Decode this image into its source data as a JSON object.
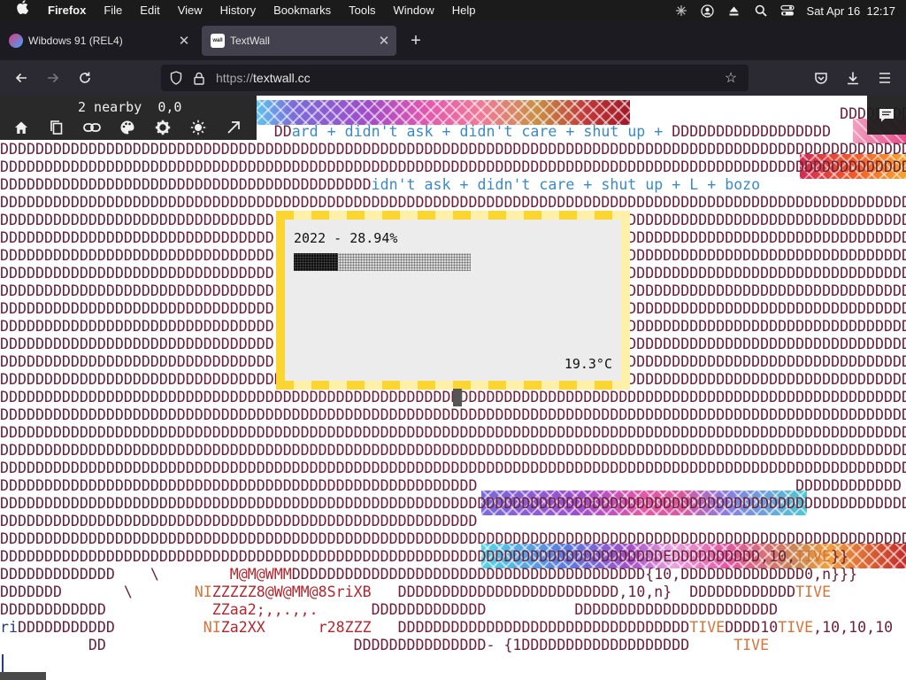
{
  "menubar": {
    "app_name": "Firefox",
    "menus": [
      "File",
      "Edit",
      "View",
      "History",
      "Bookmarks",
      "Tools",
      "Window",
      "Help"
    ],
    "clock": "Sat Apr 16  12:17"
  },
  "tabs": [
    {
      "label": "Wibdows 91 (REL4)",
      "active": false
    },
    {
      "label": "TextWall",
      "active": true
    }
  ],
  "url": {
    "protocol": "https://",
    "host": "textwall.cc"
  },
  "overlay": {
    "nearby": "2 nearby",
    "coords": "0,0",
    "tools": [
      "home-icon",
      "copy-icon",
      "link-icon",
      "palette-icon",
      "settings-icon",
      "brightness-icon",
      "expand-arrow-icon"
    ]
  },
  "widget": {
    "stat": "2022 - 28.94%",
    "progress_fraction": 0.25,
    "temperature": "19.3°C"
  },
  "wall_rows": [
    [
      {
        "t": "                                                                                               DDDDDDDDDDDDDDDDDDDDDDDDDDDDDD"
      }
    ],
    [
      {
        "t": "                               DD"
      },
      {
        "t": "ard + didn't ask + didn't care + shut up + ",
        "c": "blue"
      },
      {
        "t": "DDDDDDDDDDDDDDDDDD"
      }
    ],
    [
      {
        "t": "DDDDDDDDDDDDDDDDDDDDDDDDDDDDDDDDDDDDDDDDDDDDDDDDDDDDDDDDDDDDDDDDDDDDDDDDDDDDDDDDDDDDDDDDDDDDDDDDDDDDDDDDD"
      }
    ],
    [
      {
        "t": "DDDDDDDDDDDDDDDDDDDDDDDDDDDDDDDDDDDDDDDDDDDDDDDDDDDDDDDDDDDDDDDDDDDDDDDDDDDDDDDDDDDDDDDDDDDDDDDDDDDDDDDDD"
      }
    ],
    [
      {
        "t": "DDDDDDDDDDDDDDDDDDDDDDDDDDDDDDDDDDDDDDDDDD"
      },
      {
        "t": "idn't ask + didn't care + shut up + L + bozo",
        "c": "blue"
      }
    ],
    [
      {
        "t": "DDDDDDDDDDDDDDDDDDDDDDDDDDDDDDDDDDDDDDDDDDDDDDDDDDDDDDDDDDDDDDDDDDDDDDDDDDDDDDDDDDDDDDDDDDDDDDDDDDDDDDDDD"
      }
    ],
    [
      {
        "t": "DDDDDDDDDDDDDDDDDDDDDDDDDDDDDDD                                        DDDDDDDDDDDDDDDDDDDDDDDDDDDDDDDDD"
      }
    ],
    [
      {
        "t": "DDDDDDDDDDDDDDDDDDDDDDDDDDDDDDD                                        DDDDDDDDDDDDDDDDDDDDDDDDDDDDDDDDD"
      }
    ],
    [
      {
        "t": "DDDDDDDDDDDDDDDDDDDDDDDDDDDDDDD                                        DDDDDDDDDDDDDDDDDDDDDDDDDDDDDDDDD"
      }
    ],
    [
      {
        "t": "DDDDDDDDDDDDDDDDDDDDDDDDDDDDDDD                                        DDDDDDDDDDDDDDDDDDDDDDDDDDDDDDDDD"
      }
    ],
    [
      {
        "t": "DDDDDDDDDDDDDDDDDDDDDDDDDDDDDDD                                        DDDDDDDDDDDDDDDDDDDDDDDDDDDDDDDDD"
      }
    ],
    [
      {
        "t": "DDDDDDDDDDDDDDDDDDDDDDDDDDDDDDD                                        DDDDDDDDDDDDDDDDDDDDDDDDDDDDDDDDD"
      }
    ],
    [
      {
        "t": "DDDDDDDDDDDDDDDDDDDDDDDDDDDDDDD                                        DDDDDDDDDDDDDDDDDDDDDDDDDDDDDDDDD"
      }
    ],
    [
      {
        "t": "DDDDDDDDDDDDDDDDDDDDDDDDDDDDDDD                                        DDDDDDDDDDDDDDDDDDDDDDDDDDDDDDDDD"
      }
    ],
    [
      {
        "t": "DDDDDDDDDDDDDDDDDDDDDDDDDDDDDDD                                        DDDDDDDDDDDDDDDDDDDDDDDDDDDDDDDDD"
      }
    ],
    [
      {
        "t": "DDDDDDDDDDDDDDDDDDDDDDDDDDDDDDDDDDDDDDDDDDDDDDDDDDDDD DDDDDDDDDDDDDDDDDDDDDDDDDDDDDDDDDDDDDDDDDDDDDDDDDDD"
      }
    ],
    [
      {
        "t": "DDDDDDDDDDDDDDDDDDDDDDDDDDDDDDDDDDDDDDDDDDDDDDDDDDDDDDDDDDDDDDDDDDDDDDDDDDDDDDDDDDDDDDDDDDDDDDDDDDDDDDDDD"
      }
    ],
    [
      {
        "t": "DDDDDDDDDDDDDDDDDDDDDDDDDDDDDDDDDDDDDDDDDDDDDDDDDDDDDDDDDDDDDDDDDDDDDDDDDDDDDDDDDDDDDDDDDDDDDDDDDDDDDDDDD"
      }
    ],
    [
      {
        "t": "DDDDDDDDDDDDDDDDDDDDDDDDDDDDDDDDDDDDDDDDDDDDDDDDDDDDDDDDDDDDDDDDDDDDDDDDDDDDDDDDDDDDDDDDDDDDDDDDDDDDDDDDD"
      }
    ],
    [
      {
        "t": "DDDDDDDDDDDDDDDDDDDDDDDDDDDDDDDDDDDDDDDDDDDDDDDDDDDDDDDDDDDDDDDDDDDDDDDDDDDDDDDDDDDDDDDDDDDDDDDDDDDDDDDDD"
      }
    ],
    [
      {
        "t": "DDDDDDDDDDDDDDDDDDDDDDDDDDDDDDDDDDDDDDDDDDDDDDDDDDDDDDDDDDDDDDDDDDDDDDDDDDDDDDDDDDDDDDDDDDDDDDDDDDDDDDDDD"
      }
    ],
    [
      {
        "t": "DDDDDDDDDDDDDDDDDDDDDDDDDDDDDDDDDDDDDDDDDDDDDDDDDDDDDD                                    DDDDDDDDDDDD"
      }
    ],
    [
      {
        "t": "DDDDDDDDDDDDDDDDDDDDDDDDDDDDDDDDDDDDDDDDDDDDDDDDDDDDDDDDDDDDDDDDDDDDDDDDDDDDDDDDDDDDDDDDDDDDDDDDDDDDDDDDD"
      }
    ],
    [
      {
        "t": "DDDDDDDDDDDDDDDDDDDDDDDDDDDDDDDDDDDDDDDDDDDDDDDDDDDDDD"
      }
    ],
    [
      {
        "t": "DDDDDDDDDDDDDDDDDDDDDDDDDDDDDDDDDDDDDDDDDDDDDDDDDDDDDDDDDDDDDDDDDDDDDDDDDDDDDDDDDDDDDDDDDDDDDDDDDDDDDDDDD"
      }
    ],
    [
      {
        "t": "DDDDDDDDDDDDDDDDDDDDDDDDDDDDDDDDDDDDDDDDDDDDDDDDDDDDDDDDDDDDDDDDDDDDDDDDDDDEDDDDDDDDDD,10,"
      },
      {
        "t": "TIVE",
        "c": "orange"
      },
      {
        "t": "}}"
      }
    ],
    [
      {
        "t": "DDDDDDDDDDDDD    \\        "
      },
      {
        "t": "M@M@WMM",
        "c": "red"
      },
      {
        "t": "DDDDDDDDDDDDDDDDDDDDDDDDDDDDDDDDDDDDDDDD{10,DDDDDDDDDDDDDD0,n}}}"
      }
    ],
    [
      {
        "t": "DDDDDDD       \\       "
      },
      {
        "t": "NI",
        "c": "orange"
      },
      {
        "t": "ZZZZZ8@W@MM@8SriXB",
        "c": "red"
      },
      {
        "t": "   DDDDDDDDDDDDDDDDDDDDDDDDD,10,n}  DDDDDDDDDDDD"
      },
      {
        "t": "TIVE",
        "c": "orange"
      }
    ],
    [
      {
        "t": "DDDDDDDDDDDD            "
      },
      {
        "t": "ZZaa2;,,.,,.",
        "c": "red"
      },
      {
        "t": "      DDDDDDDDDDDDD          DDDDDDDDDDDDDDDDDDDDDDD"
      }
    ],
    [
      {
        "t": "ri",
        "c": "navy"
      },
      {
        "t": "DDDDDDDDDDD          "
      },
      {
        "t": "NI",
        "c": "orange"
      },
      {
        "t": "Za2XX",
        "c": "red"
      },
      {
        "t": "      "
      },
      {
        "t": "r28ZZZ",
        "c": "red"
      },
      {
        "t": "   DDDDDDDDDDDDDDDDDDDDDDDDDDDDDDDDD"
      },
      {
        "t": "TIVE",
        "c": "orange"
      },
      {
        "t": "DDDD10"
      },
      {
        "t": "TIVE",
        "c": "orange"
      },
      {
        "t": ",10,10,10"
      }
    ],
    [
      {
        "t": "          DD                            DDDDDDDDDDDDDDD- {1DDDDDDDDDDDDDDDDDDD     "
      },
      {
        "t": "TIVE",
        "c": "orange"
      }
    ]
  ]
}
